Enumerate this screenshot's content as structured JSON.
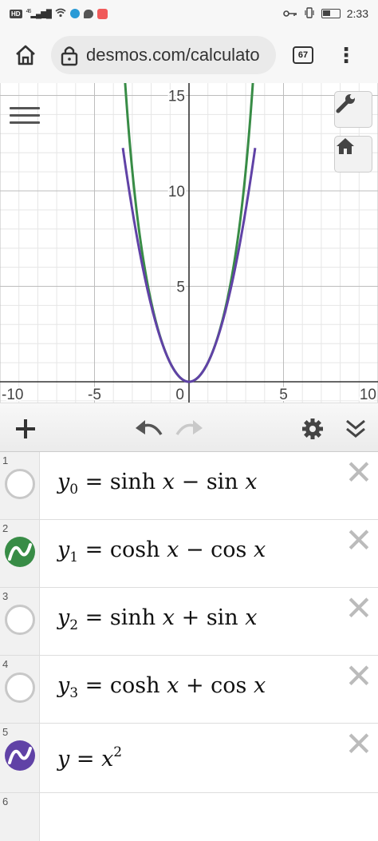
{
  "status_bar": {
    "network": "HD",
    "signal": "46",
    "time": "2:33"
  },
  "browser": {
    "url": "desmos.com/calculato",
    "tab_count": "67"
  },
  "graph": {
    "x_tick_labels": [
      "-10",
      "-5",
      "0",
      "5",
      "10"
    ],
    "y_tick_labels": [
      "5",
      "10",
      "15"
    ],
    "curve_colors": {
      "green": "#388c46",
      "purple": "#6042a6"
    }
  },
  "chart_data": {
    "type": "line",
    "xlim": [
      -10,
      10
    ],
    "ylim": [
      0,
      15.5
    ],
    "series": [
      {
        "color": "#388c46",
        "x": [
          -2.5,
          -2,
          -1.5,
          -1,
          -0.5,
          0,
          0.5,
          1,
          1.5,
          2,
          2.5
        ],
        "values": [
          6.93,
          4.18,
          2.28,
          1.0,
          0.25,
          0.0,
          0.25,
          1.0,
          2.28,
          4.18,
          6.93
        ]
      },
      {
        "color": "#6042a6",
        "x": [
          -2.5,
          -2,
          -1.5,
          -1,
          -0.5,
          0,
          0.5,
          1,
          1.5,
          2,
          2.5
        ],
        "values": [
          6.25,
          4.0,
          2.25,
          1.0,
          0.25,
          0.0,
          0.25,
          1.0,
          2.25,
          4.0,
          6.25
        ]
      }
    ]
  },
  "expressions": [
    {
      "num": "1",
      "lhs": "y",
      "sub": "0",
      "fn": "sinh",
      "op": "−",
      "fn2": "sin",
      "visible": false,
      "color": ""
    },
    {
      "num": "2",
      "lhs": "y",
      "sub": "1",
      "fn": "cosh",
      "op": "−",
      "fn2": "cos",
      "visible": true,
      "color": "#388c46"
    },
    {
      "num": "3",
      "lhs": "y",
      "sub": "2",
      "fn": "sinh",
      "op": "+",
      "fn2": "sin",
      "visible": false,
      "color": ""
    },
    {
      "num": "4",
      "lhs": "y",
      "sub": "3",
      "fn": "cosh",
      "op": "+",
      "fn2": "cos",
      "visible": false,
      "color": ""
    },
    {
      "num": "5",
      "lhs": "y",
      "rhs_var": "x",
      "rhs_exp": "2",
      "visible": true,
      "color": "#6042a6"
    },
    {
      "num": "6"
    }
  ]
}
